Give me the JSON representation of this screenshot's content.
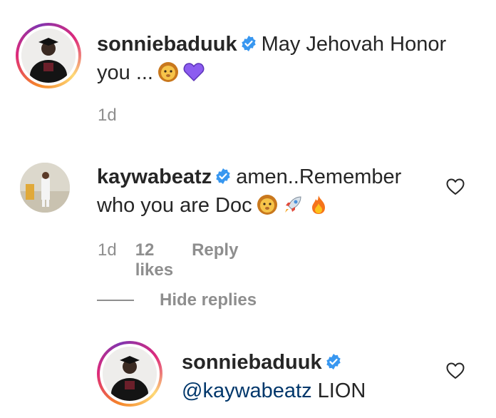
{
  "comments": [
    {
      "username": "sonniebaduuk",
      "line1": "May Jehovah Honor",
      "line2": "you ...",
      "time": "1d"
    },
    {
      "username": "kaywabeatz",
      "line1": "amen..Remember",
      "line2": "who you are Doc",
      "time": "1d",
      "likes": "12 likes",
      "reply": "Reply"
    }
  ],
  "replies_toggle": "Hide replies",
  "reply": {
    "username": "sonniebaduuk",
    "mention": "@kaywabeatz",
    "text": "LION"
  },
  "colors": {
    "verified": "#3897f0",
    "meta": "#8e8e8e",
    "mention": "#00376b"
  }
}
